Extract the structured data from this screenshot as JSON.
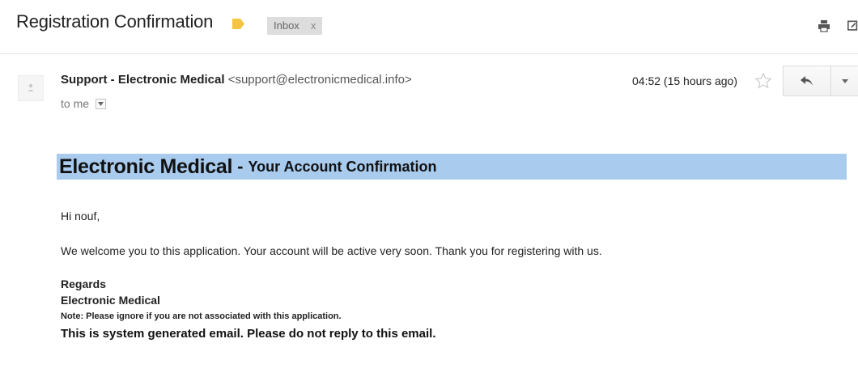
{
  "header": {
    "subject": "Registration Confirmation",
    "label_chip": "Inbox",
    "label_chip_close": "x",
    "label_color": "#f4c542"
  },
  "message": {
    "sender_name": "Support - Electronic Medical",
    "sender_email": "<support@electronicmedical.info>",
    "recipient": "to me",
    "timestamp": "04:52 (15 hours ago)"
  },
  "email_body": {
    "banner_brand": "Electronic Medical",
    "banner_separator": "-",
    "banner_heading": "Your Account Confirmation",
    "banner_color": "#a9cbee",
    "greeting": "Hi nouf,",
    "welcome_text": "We welcome you to this application. Your account will be active very soon. Thank you for registering with us.",
    "regards": "Regards",
    "signature": "Electronic Medical",
    "note": "Note: Please ignore if you are not associated with this application.",
    "system_message": "This is system generated email. Please do not reply to this email."
  },
  "icons": {
    "print": "print-icon",
    "new_window": "new-window-icon",
    "star": "star-icon",
    "reply": "reply-icon",
    "more": "chevron-down-icon",
    "avatar": "person-icon"
  }
}
